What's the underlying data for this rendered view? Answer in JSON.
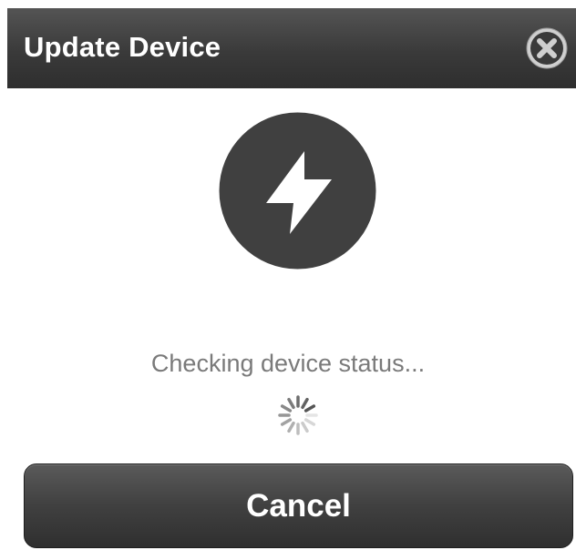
{
  "dialog": {
    "title": "Update Device",
    "close_icon": "close-x-icon",
    "device_icon": "lightning-bolt-icon",
    "status": "Checking device status...",
    "spinner_icon": "loading-spinner-icon",
    "cancel_label": "Cancel"
  },
  "colors": {
    "titlebar": "#3c3c3c",
    "icon_circle": "#404040",
    "status_text": "#7a7a7a",
    "button": "#444444"
  }
}
